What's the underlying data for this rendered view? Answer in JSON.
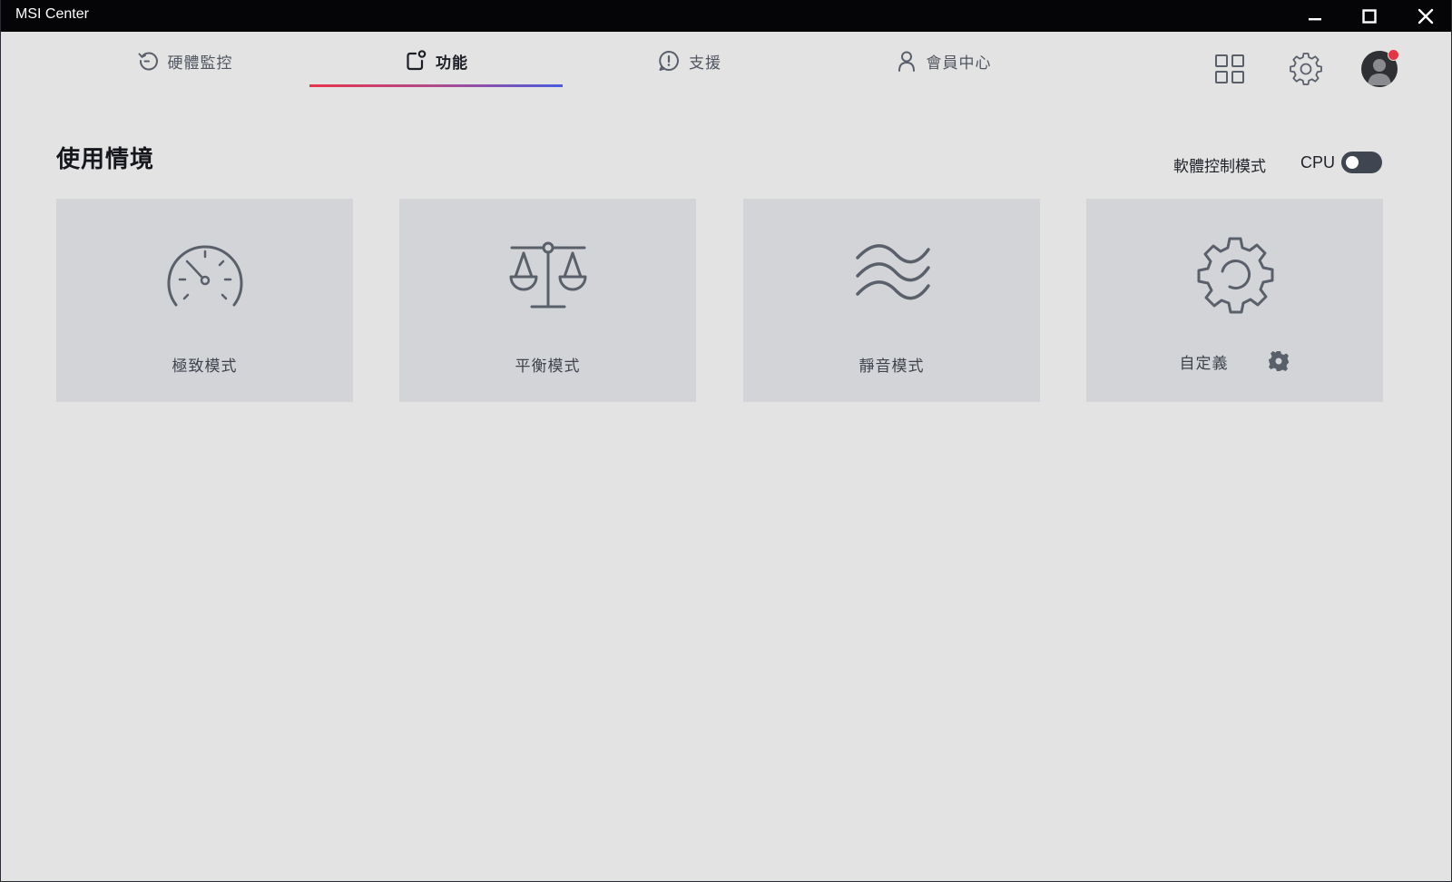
{
  "window": {
    "title": "MSI Center"
  },
  "nav": {
    "tabs": [
      {
        "label": "硬體監控",
        "icon": "clock-refresh-icon",
        "active": false
      },
      {
        "label": "功能",
        "icon": "feature-box-icon",
        "active": true
      },
      {
        "label": "支援",
        "icon": "support-alert-icon",
        "active": false
      },
      {
        "label": "會員中心",
        "icon": "user-icon",
        "active": false
      }
    ],
    "right_icons": [
      "grid-apps-icon",
      "gear-icon",
      "avatar"
    ]
  },
  "section": {
    "title": "使用情境",
    "mode_label": "軟體控制模式",
    "cpu_label": "CPU",
    "cpu_toggle_on": false
  },
  "cards": [
    {
      "label": "極致模式",
      "icon": "speedometer-icon"
    },
    {
      "label": "平衡模式",
      "icon": "balance-scale-icon"
    },
    {
      "label": "靜音模式",
      "icon": "waves-icon"
    },
    {
      "label": "自定義",
      "icon": "gear-icon",
      "settings_icon": "small-gear-icon"
    }
  ],
  "colors": {
    "background": "#e3e3e4",
    "card": "#d3d4d8",
    "titlebar": "#050507",
    "icon": "#5a606a",
    "accent_start": "#e8344a",
    "accent_end": "#4a5be0",
    "notification_dot": "#e23545"
  }
}
